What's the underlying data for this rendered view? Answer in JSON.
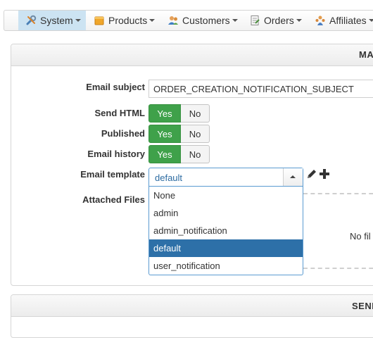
{
  "nav": {
    "items": [
      {
        "label": "System",
        "icon": "wrench-icon",
        "active": true
      },
      {
        "label": "Products",
        "icon": "box-icon"
      },
      {
        "label": "Customers",
        "icon": "users-icon"
      },
      {
        "label": "Orders",
        "icon": "document-icon"
      },
      {
        "label": "Affiliates",
        "icon": "affiliates-icon"
      }
    ]
  },
  "panel1": {
    "title": "MA"
  },
  "form": {
    "email_subject": {
      "label": "Email subject",
      "value": "ORDER_CREATION_NOTIFICATION_SUBJECT"
    },
    "send_html": {
      "label": "Send HTML",
      "yes": "Yes",
      "no": "No",
      "value": "Yes"
    },
    "published": {
      "label": "Published",
      "yes": "Yes",
      "no": "No",
      "value": "Yes"
    },
    "email_history": {
      "label": "Email history",
      "yes": "Yes",
      "no": "No",
      "value": "Yes"
    },
    "email_template": {
      "label": "Email template",
      "value": "default",
      "options": [
        "None",
        "admin",
        "admin_notification",
        "default",
        "user_notification"
      ],
      "selected": "default"
    },
    "attached_files": {
      "label": "Attached Files",
      "empty_text": "No fil"
    }
  },
  "panel2": {
    "title": "SEND"
  },
  "colors": {
    "accent_green": "#3fa14a",
    "select_blue": "#2d70a8",
    "nav_active": "#cce3f2"
  }
}
